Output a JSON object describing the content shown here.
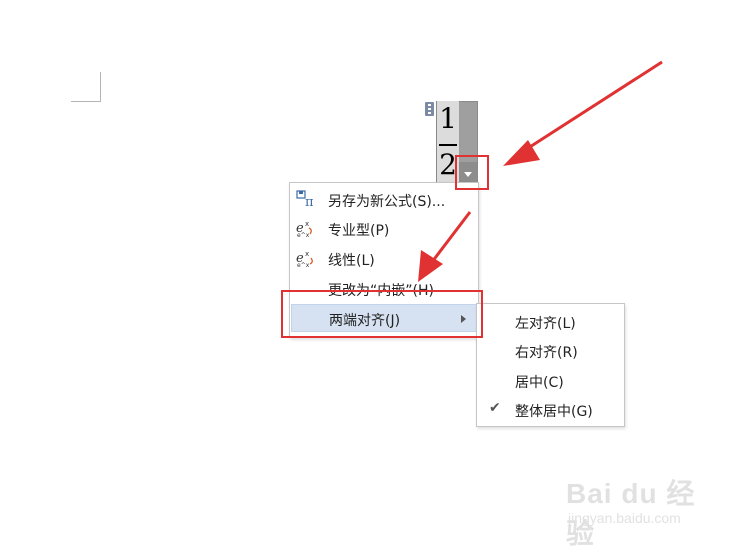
{
  "equation": {
    "numerator": "1",
    "denominator": "2"
  },
  "context_menu": {
    "items": [
      {
        "label": "另存为新公式(S)...",
        "icon": "save-as-formula-icon"
      },
      {
        "label": "专业型(P)",
        "icon": "professional-format-icon"
      },
      {
        "label": "线性(L)",
        "icon": "linear-format-icon"
      },
      {
        "label": "更改为“内嵌”(H)",
        "icon": ""
      },
      {
        "label": "两端对齐(J)",
        "icon": "",
        "has_submenu": true,
        "highlighted": true
      }
    ]
  },
  "submenu": {
    "items": [
      {
        "label": "左对齐(L)",
        "checked": false
      },
      {
        "label": "右对齐(R)",
        "checked": false
      },
      {
        "label": "居中(C)",
        "checked": false
      },
      {
        "label": "整体居中(G)",
        "checked": true
      }
    ]
  },
  "colors": {
    "annotation_red": "#e03232",
    "highlight": "#d6e1f1"
  },
  "watermark": {
    "logo": "Bai du 经验",
    "url": "jingyan.baidu.com"
  }
}
